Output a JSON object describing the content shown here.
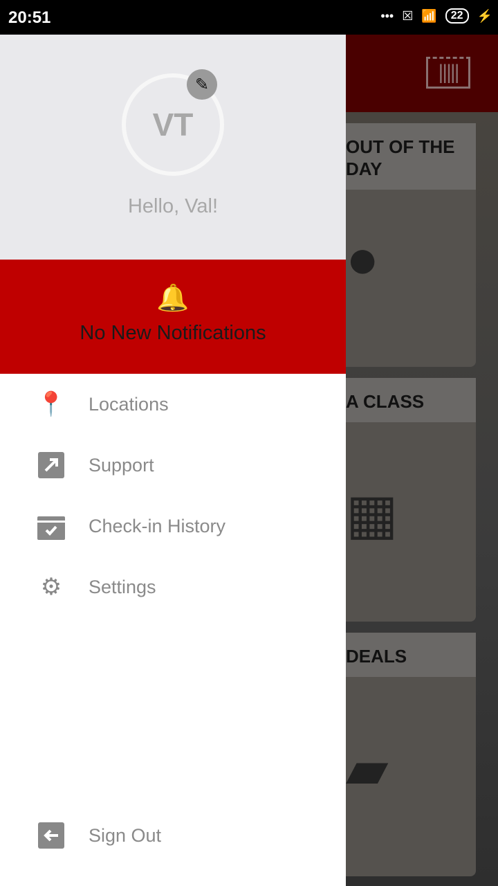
{
  "status_bar": {
    "time": "20:51",
    "battery": "22",
    "icons": [
      "more-dots-icon",
      "sim-x-icon",
      "wifi-icon",
      "battery-icon",
      "charging-icon"
    ]
  },
  "background": {
    "cards": [
      {
        "title": "OUT OF THE DAY",
        "icon": "whistle-icon"
      },
      {
        "title": "A CLASS",
        "icon": "calendar-icon"
      },
      {
        "title": "DEALS",
        "icon": "phone-icon"
      }
    ],
    "barcode_icon": "barcode-scan-icon",
    "accent": "#4a0000"
  },
  "drawer": {
    "avatar_initials": "VT",
    "greeting": "Hello, Val!",
    "notifications": "No New Notifications",
    "notification_color": "#bf0000",
    "menu": [
      {
        "label": "Locations",
        "icon": "location-pin-icon"
      },
      {
        "label": "Support",
        "icon": "external-link-icon"
      },
      {
        "label": "Check-in History",
        "icon": "calendar-check-icon"
      },
      {
        "label": "Settings",
        "icon": "gear-icon"
      }
    ],
    "sign_out": {
      "label": "Sign Out",
      "icon": "sign-out-icon"
    }
  }
}
